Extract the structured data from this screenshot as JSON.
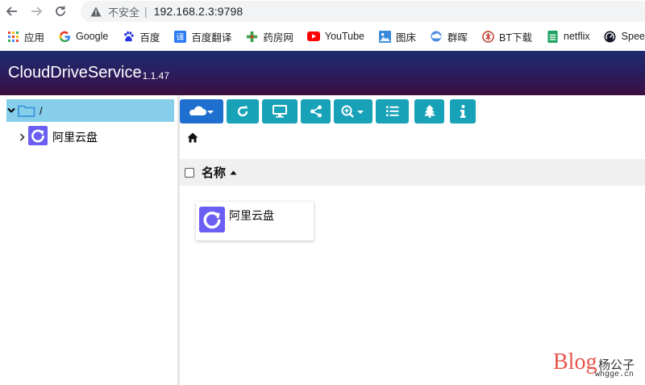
{
  "browser": {
    "security_label": "不安全",
    "separator": "|",
    "url": "192.168.2.3:9798"
  },
  "bookmarks": [
    {
      "label": "应用",
      "icon": "apps-grid-icon"
    },
    {
      "label": "Google",
      "icon": "google-icon"
    },
    {
      "label": "百度",
      "icon": "baidu-paw-icon"
    },
    {
      "label": "百度翻译",
      "icon": "baidu-translate-icon"
    },
    {
      "label": "药房网",
      "icon": "pharmacy-icon"
    },
    {
      "label": "YouTube",
      "icon": "youtube-icon"
    },
    {
      "label": "图床",
      "icon": "image-icon"
    },
    {
      "label": "群晖",
      "icon": "synology-cloud-icon"
    },
    {
      "label": "BT下载",
      "icon": "bt-download-icon"
    },
    {
      "label": "netflix",
      "icon": "sheet-icon"
    },
    {
      "label": "Speedt",
      "icon": "speedtest-icon"
    }
  ],
  "app": {
    "title": "CloudDriveService",
    "version": "1.1.47"
  },
  "sidebar": {
    "root_label": "/",
    "children": [
      {
        "label": "阿里云盘",
        "icon": "aliyun-drive-logo-icon"
      }
    ]
  },
  "list": {
    "column_name": "名称",
    "items": [
      {
        "label": "阿里云盘",
        "icon": "aliyun-drive-logo-icon"
      }
    ]
  },
  "colors": {
    "header_start": "#1c2c6e",
    "header_end": "#3b0f3f",
    "toolbar_button": "#17a2b8",
    "toolbar_primary": "#1f6fd1",
    "tree_selected": "#87ceeb"
  },
  "watermark": {
    "brand": "Blog",
    "name": "杨公子",
    "site": "whgge.cn"
  }
}
